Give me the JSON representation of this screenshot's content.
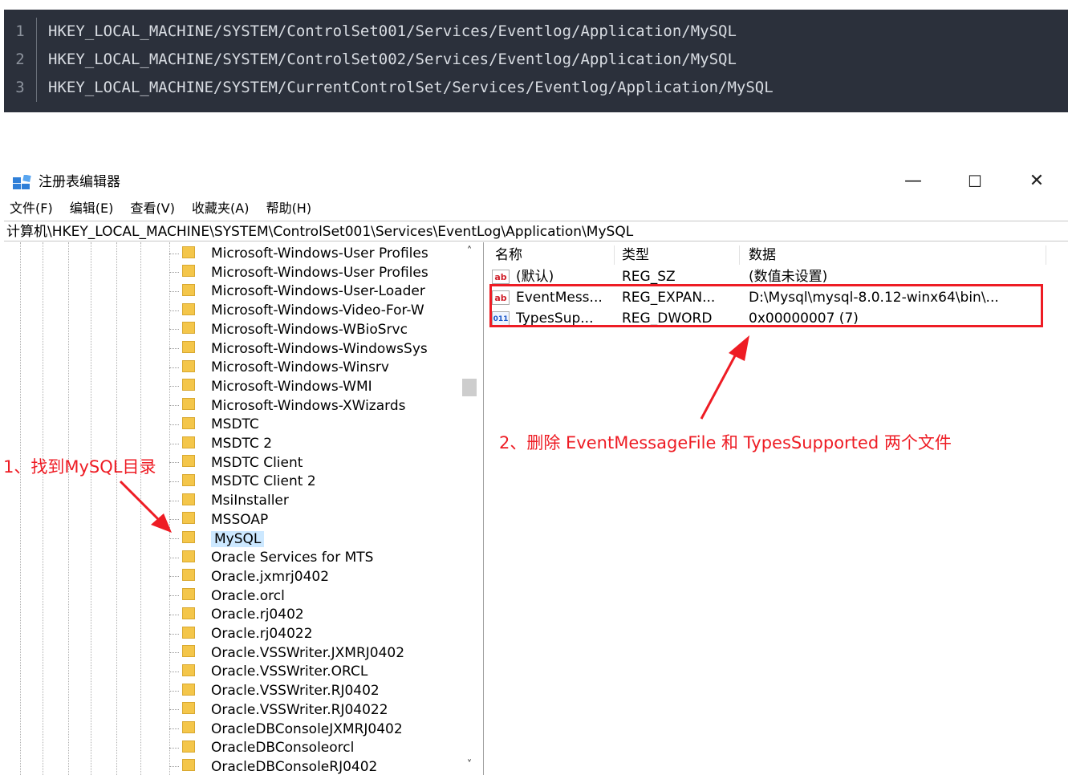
{
  "code": {
    "lines": [
      {
        "num": "1",
        "text": "HKEY_LOCAL_MACHINE/SYSTEM/ControlSet001/Services/Eventlog/Application/MySQL"
      },
      {
        "num": "2",
        "text": "HKEY_LOCAL_MACHINE/SYSTEM/ControlSet002/Services/Eventlog/Application/MySQL"
      },
      {
        "num": "3",
        "text": "HKEY_LOCAL_MACHINE/SYSTEM/CurrentControlSet/Services/Eventlog/Application/MySQL"
      }
    ]
  },
  "window": {
    "title": "注册表编辑器",
    "minimize": "—",
    "maximize": "☐",
    "close": "✕"
  },
  "menu": [
    "文件(F)",
    "编辑(E)",
    "查看(V)",
    "收藏夹(A)",
    "帮助(H)"
  ],
  "address": "计算机\\HKEY_LOCAL_MACHINE\\SYSTEM\\ControlSet001\\Services\\EventLog\\Application\\MySQL",
  "tree": {
    "items": [
      "Microsoft-Windows-User Profiles",
      "Microsoft-Windows-User Profiles",
      "Microsoft-Windows-User-Loader",
      "Microsoft-Windows-Video-For-W",
      "Microsoft-Windows-WBioSrvc",
      "Microsoft-Windows-WindowsSys",
      "Microsoft-Windows-Winsrv",
      "Microsoft-Windows-WMI",
      "Microsoft-Windows-XWizards",
      "MSDTC",
      "MSDTC 2",
      "MSDTC Client",
      "MSDTC Client 2",
      "MsiInstaller",
      "MSSOAP",
      "MySQL",
      "Oracle Services for MTS",
      "Oracle.jxmrj0402",
      "Oracle.orcl",
      "Oracle.rj0402",
      "Oracle.rj04022",
      "Oracle.VSSWriter.JXMRJ0402",
      "Oracle.VSSWriter.ORCL",
      "Oracle.VSSWriter.RJ0402",
      "Oracle.VSSWriter.RJ04022",
      "OracleDBConsoleJXMRJ0402",
      "OracleDBConsoleorcl",
      "OracleDBConsoleRJ0402"
    ],
    "selected": "MySQL"
  },
  "list": {
    "headers": {
      "name": "名称",
      "type": "类型",
      "data": "数据"
    },
    "rows": [
      {
        "icon": "string-value-icon",
        "badge": "ab",
        "name": "(默认)",
        "type": "REG_SZ",
        "data": "(数值未设置)"
      },
      {
        "icon": "string-value-icon",
        "badge": "ab",
        "name": "EventMess...",
        "type": "REG_EXPAN...",
        "data": "D:\\Mysql\\mysql-8.0.12-winx64\\bin\\..."
      },
      {
        "icon": "binary-value-icon",
        "badge": "011",
        "name": "TypesSup...",
        "type": "REG_DWORD",
        "data": "0x00000007 (7)"
      }
    ]
  },
  "annotations": {
    "step1": "1、找到MySQL目录",
    "step2": "2、删除 EventMessageFile 和 TypesSupported 两个文件"
  },
  "colors": {
    "annotation": "#ee1c24",
    "code_bg": "#2b303b",
    "selection": "#cce8ff"
  }
}
